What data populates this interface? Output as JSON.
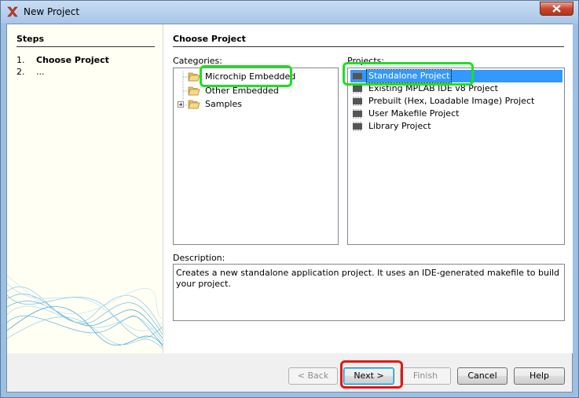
{
  "window": {
    "title": "New Project"
  },
  "steps": {
    "title": "Steps",
    "items": [
      {
        "num": "1.",
        "label": "Choose Project"
      },
      {
        "num": "2.",
        "label": "..."
      }
    ]
  },
  "main": {
    "title": "Choose Project",
    "categories_label": "Categories:",
    "projects_label": "Projects:",
    "categories": [
      {
        "label": "Microchip Embedded",
        "expander": false
      },
      {
        "label": "Other Embedded",
        "expander": false
      },
      {
        "label": "Samples",
        "expander": true
      }
    ],
    "projects": [
      {
        "label": "Standalone Project",
        "selected": true
      },
      {
        "label": "Existing MPLAB IDE v8 Project",
        "selected": false
      },
      {
        "label": "Prebuilt (Hex, Loadable Image) Project",
        "selected": false
      },
      {
        "label": "User Makefile Project",
        "selected": false
      },
      {
        "label": "Library Project",
        "selected": false
      }
    ],
    "description_label": "Description:",
    "description": "Creates a new standalone application project. It uses an IDE-generated makefile to build your project."
  },
  "buttons": {
    "back": "< Back",
    "next": "Next >",
    "finish": "Finish",
    "cancel": "Cancel",
    "help": "Help"
  },
  "annotation_colors": {
    "green": "#1fe01f",
    "red": "#e01818"
  }
}
